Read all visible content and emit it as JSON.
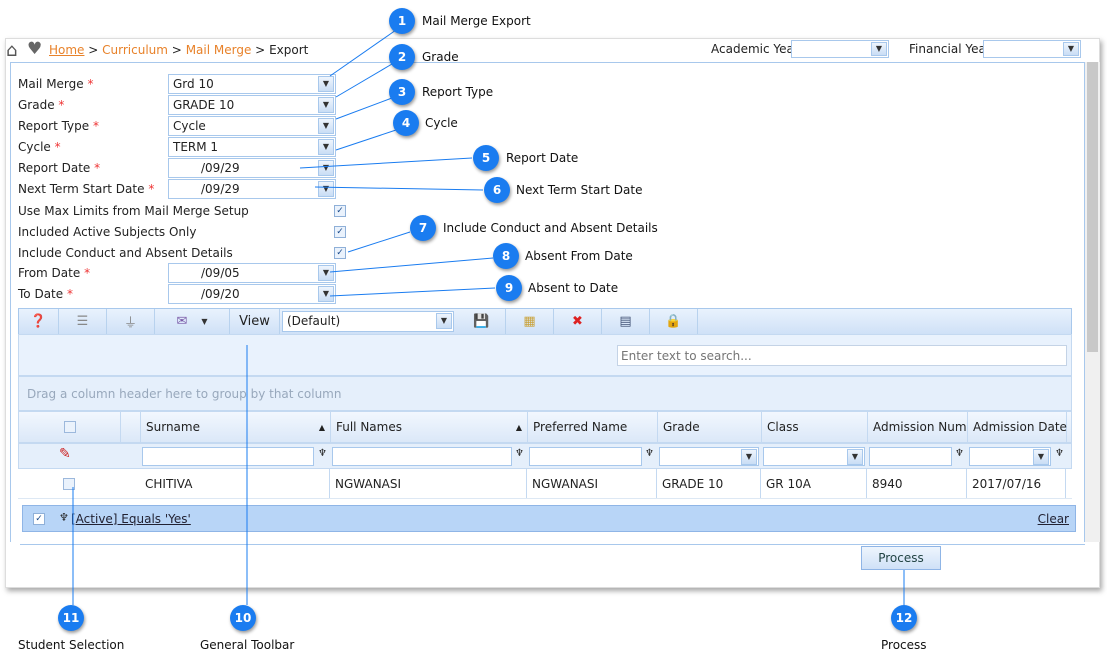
{
  "breadcrumb": {
    "home": "Home",
    "curriculum": "Curriculum",
    "mail_merge": "Mail Merge",
    "current": "Export",
    "sep": ">"
  },
  "header": {
    "academic_year_label": "Academic Year",
    "academic_year_value": "",
    "financial_year_label": "Financial Year",
    "financial_year_value": ""
  },
  "form": {
    "mail_merge": {
      "label": "Mail Merge",
      "value": "Grd 10"
    },
    "grade": {
      "label": "Grade",
      "value": "GRADE 10"
    },
    "report_type": {
      "label": "Report Type",
      "value": "Cycle"
    },
    "cycle": {
      "label": "Cycle",
      "value": "TERM 1"
    },
    "report_date": {
      "label": "Report Date",
      "value": "/09/29"
    },
    "next_term": {
      "label": "Next Term Start Date",
      "value": "/09/29"
    },
    "use_max": {
      "label": "Use Max Limits from Mail Merge Setup",
      "checked": true
    },
    "active_subjects": {
      "label": "Included Active Subjects Only",
      "checked": true
    },
    "conduct": {
      "label": "Include Conduct and Absent Details",
      "checked": true
    },
    "from_date": {
      "label": "From Date",
      "value": "/09/05"
    },
    "to_date": {
      "label": "To Date",
      "value": "/09/20"
    },
    "required_mark": "*"
  },
  "toolbar": {
    "view_label": "View",
    "layout_value": "(Default)"
  },
  "grid": {
    "search_placeholder": "Enter text to search...",
    "group_hint": "Drag a column header here to group by that column",
    "columns": [
      "Surname",
      "Full Names",
      "Preferred Name",
      "Grade",
      "Class",
      "Admission Number",
      "Admission Date"
    ],
    "rows": [
      [
        "CHITIVA",
        "NGWANASI",
        "NGWANASI",
        "GRADE 10",
        "GR 10A",
        "8940",
        "2017/07/16"
      ]
    ],
    "filter_text": "[Active] Equals 'Yes'",
    "clear_label": "Clear"
  },
  "process_label": "Process",
  "callouts": [
    {
      "n": "1",
      "label": "Mail Merge Export"
    },
    {
      "n": "2",
      "label": "Grade"
    },
    {
      "n": "3",
      "label": "Report Type"
    },
    {
      "n": "4",
      "label": "Cycle"
    },
    {
      "n": "5",
      "label": "Report Date"
    },
    {
      "n": "6",
      "label": "Next Term Start Date"
    },
    {
      "n": "7",
      "label": "Include Conduct and Absent Details"
    },
    {
      "n": "8",
      "label": "Absent From Date"
    },
    {
      "n": "9",
      "label": "Absent to Date"
    },
    {
      "n": "10",
      "label": "General Toolbar"
    },
    {
      "n": "11",
      "label": "Student Selection"
    },
    {
      "n": "12",
      "label": "Process"
    }
  ],
  "colors": {
    "callout": "#1a7cf0",
    "breadcrumb_link": "#e8822a",
    "required": "#e33333",
    "grid_border": "#a8c8ec"
  }
}
